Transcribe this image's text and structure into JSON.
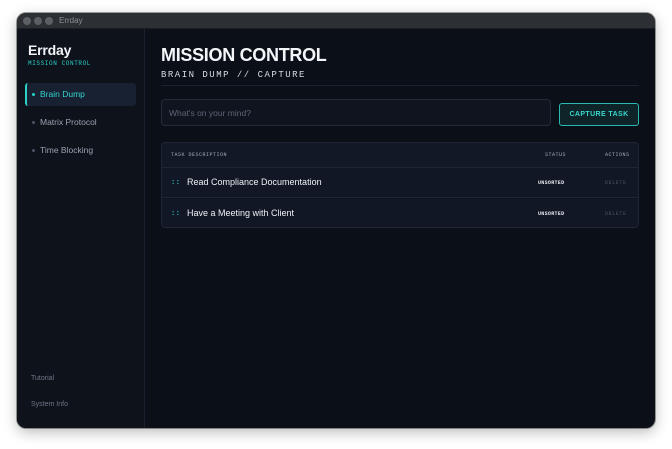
{
  "window": {
    "title": "Errday"
  },
  "sidebar": {
    "brand": "Errday",
    "tagline": "MISSION CONTROL",
    "items": [
      {
        "label": "Brain Dump",
        "active": true
      },
      {
        "label": "Matrix Protocol",
        "active": false
      },
      {
        "label": "Time Blocking",
        "active": false
      }
    ],
    "footer": {
      "tutorial": "Tutorial",
      "system_info": "System Info"
    }
  },
  "main": {
    "title": "MISSION CONTROL",
    "subtitle": "BRAIN DUMP // CAPTURE",
    "input": {
      "value": "",
      "placeholder": "What's on your mind?"
    },
    "capture_button": "CAPTURE TASK",
    "table": {
      "headers": {
        "description": "TASK DESCRIPTION",
        "status": "STATUS",
        "actions": "ACTIONS"
      },
      "rows": [
        {
          "handle": "::",
          "description": "Read Compliance Documentation",
          "status": "UNSORTED",
          "action": "DELETE"
        },
        {
          "handle": "::",
          "description": "Have a Meeting with Client",
          "status": "UNSORTED",
          "action": "DELETE"
        }
      ]
    }
  },
  "colors": {
    "accent": "#2ad1c9",
    "background": "#0b0f18",
    "sidebar": "#0e121b"
  }
}
